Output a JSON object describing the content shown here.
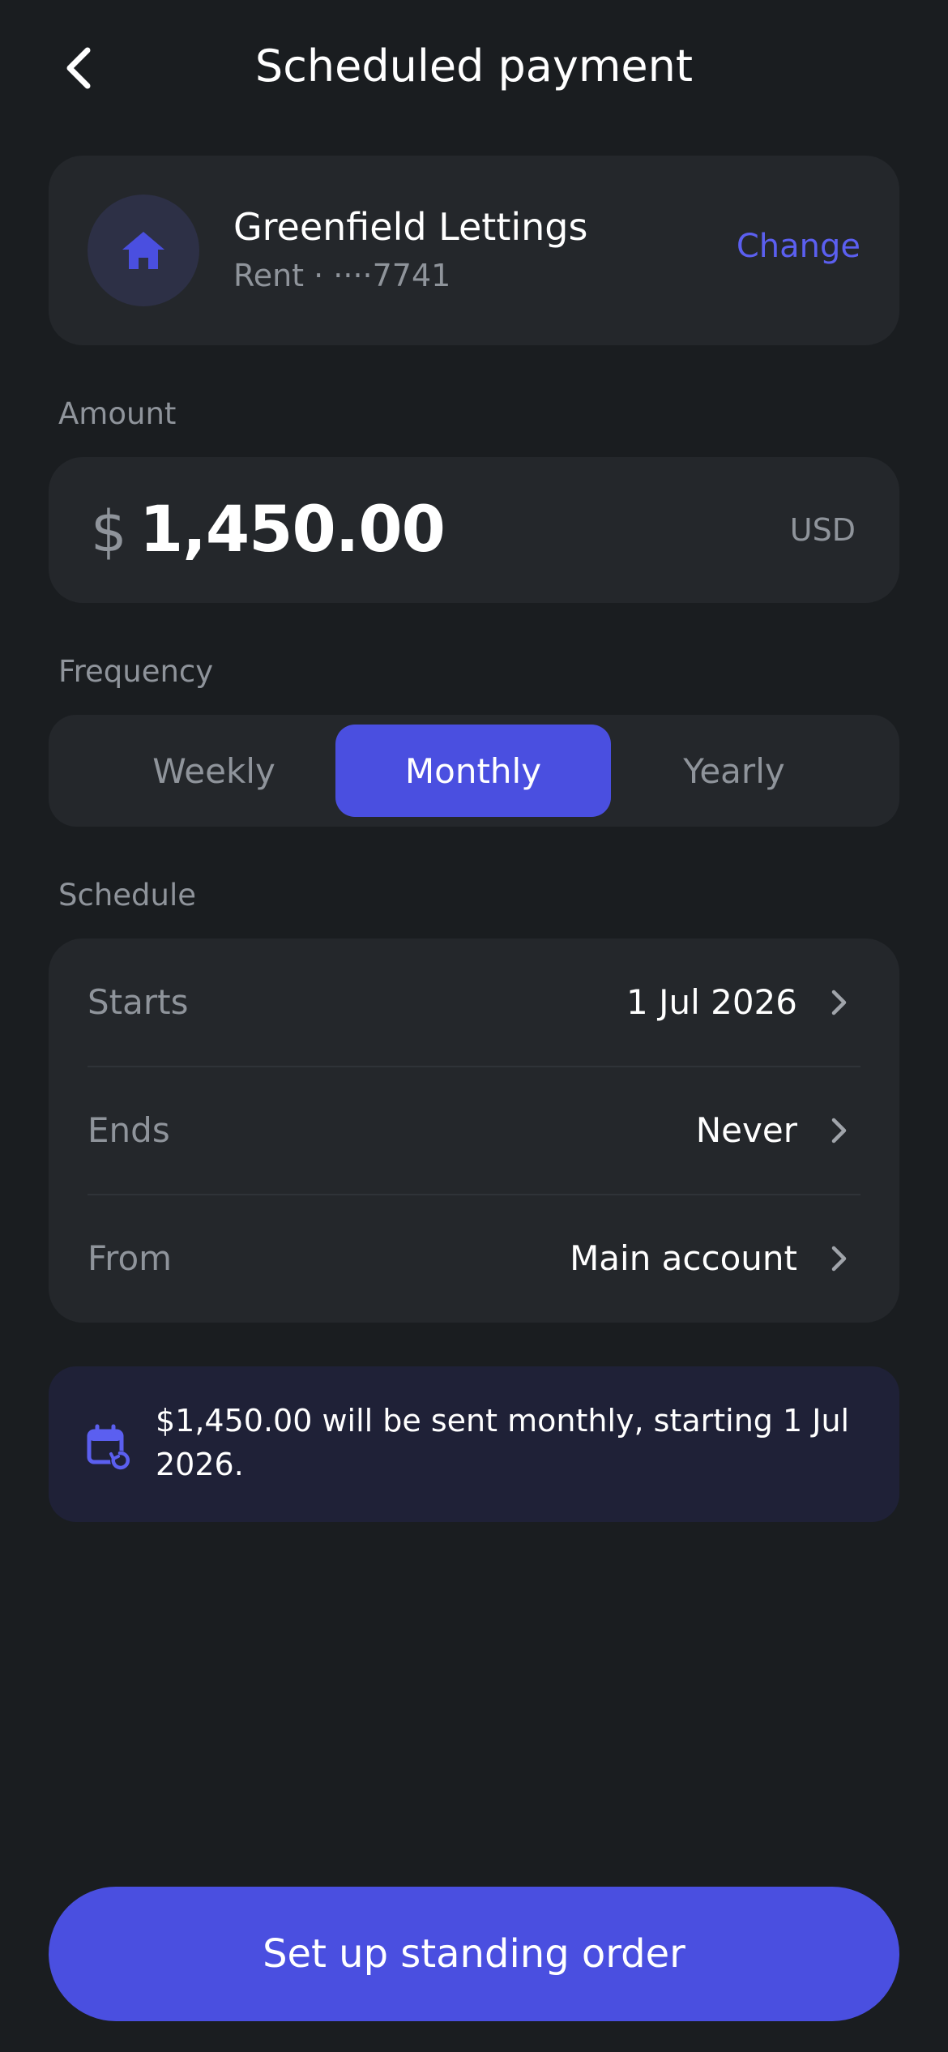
{
  "header": {
    "title": "Scheduled payment",
    "back_icon": "chevron-left-icon"
  },
  "payee": {
    "name": "Greenfield Lettings",
    "subtitle": "Rent · ····7741",
    "icon": "home-icon",
    "change_label": "Change"
  },
  "amount": {
    "label": "Amount",
    "symbol": "$",
    "value": "1,450.00",
    "currency": "USD"
  },
  "frequency": {
    "label": "Frequency",
    "options": [
      "Weekly",
      "Monthly",
      "Yearly"
    ],
    "selected": "Monthly"
  },
  "schedule": {
    "label": "Schedule",
    "rows": [
      {
        "label": "Starts",
        "value": "1 Jul 2026"
      },
      {
        "label": "Ends",
        "value": "Never"
      },
      {
        "label": "From",
        "value": "Main account"
      }
    ]
  },
  "info": {
    "icon": "calendar-repeat-icon",
    "text": "$1,450.00 will be sent monthly, starting 1 Jul 2026."
  },
  "cta": {
    "label": "Set up standing order"
  },
  "colors": {
    "background": "#1a1d20",
    "card": "#24272b",
    "accent": "#4a4fe0",
    "accent_text": "#5b5ff0",
    "muted": "#8f949b",
    "info_bg": "#1f2137"
  }
}
